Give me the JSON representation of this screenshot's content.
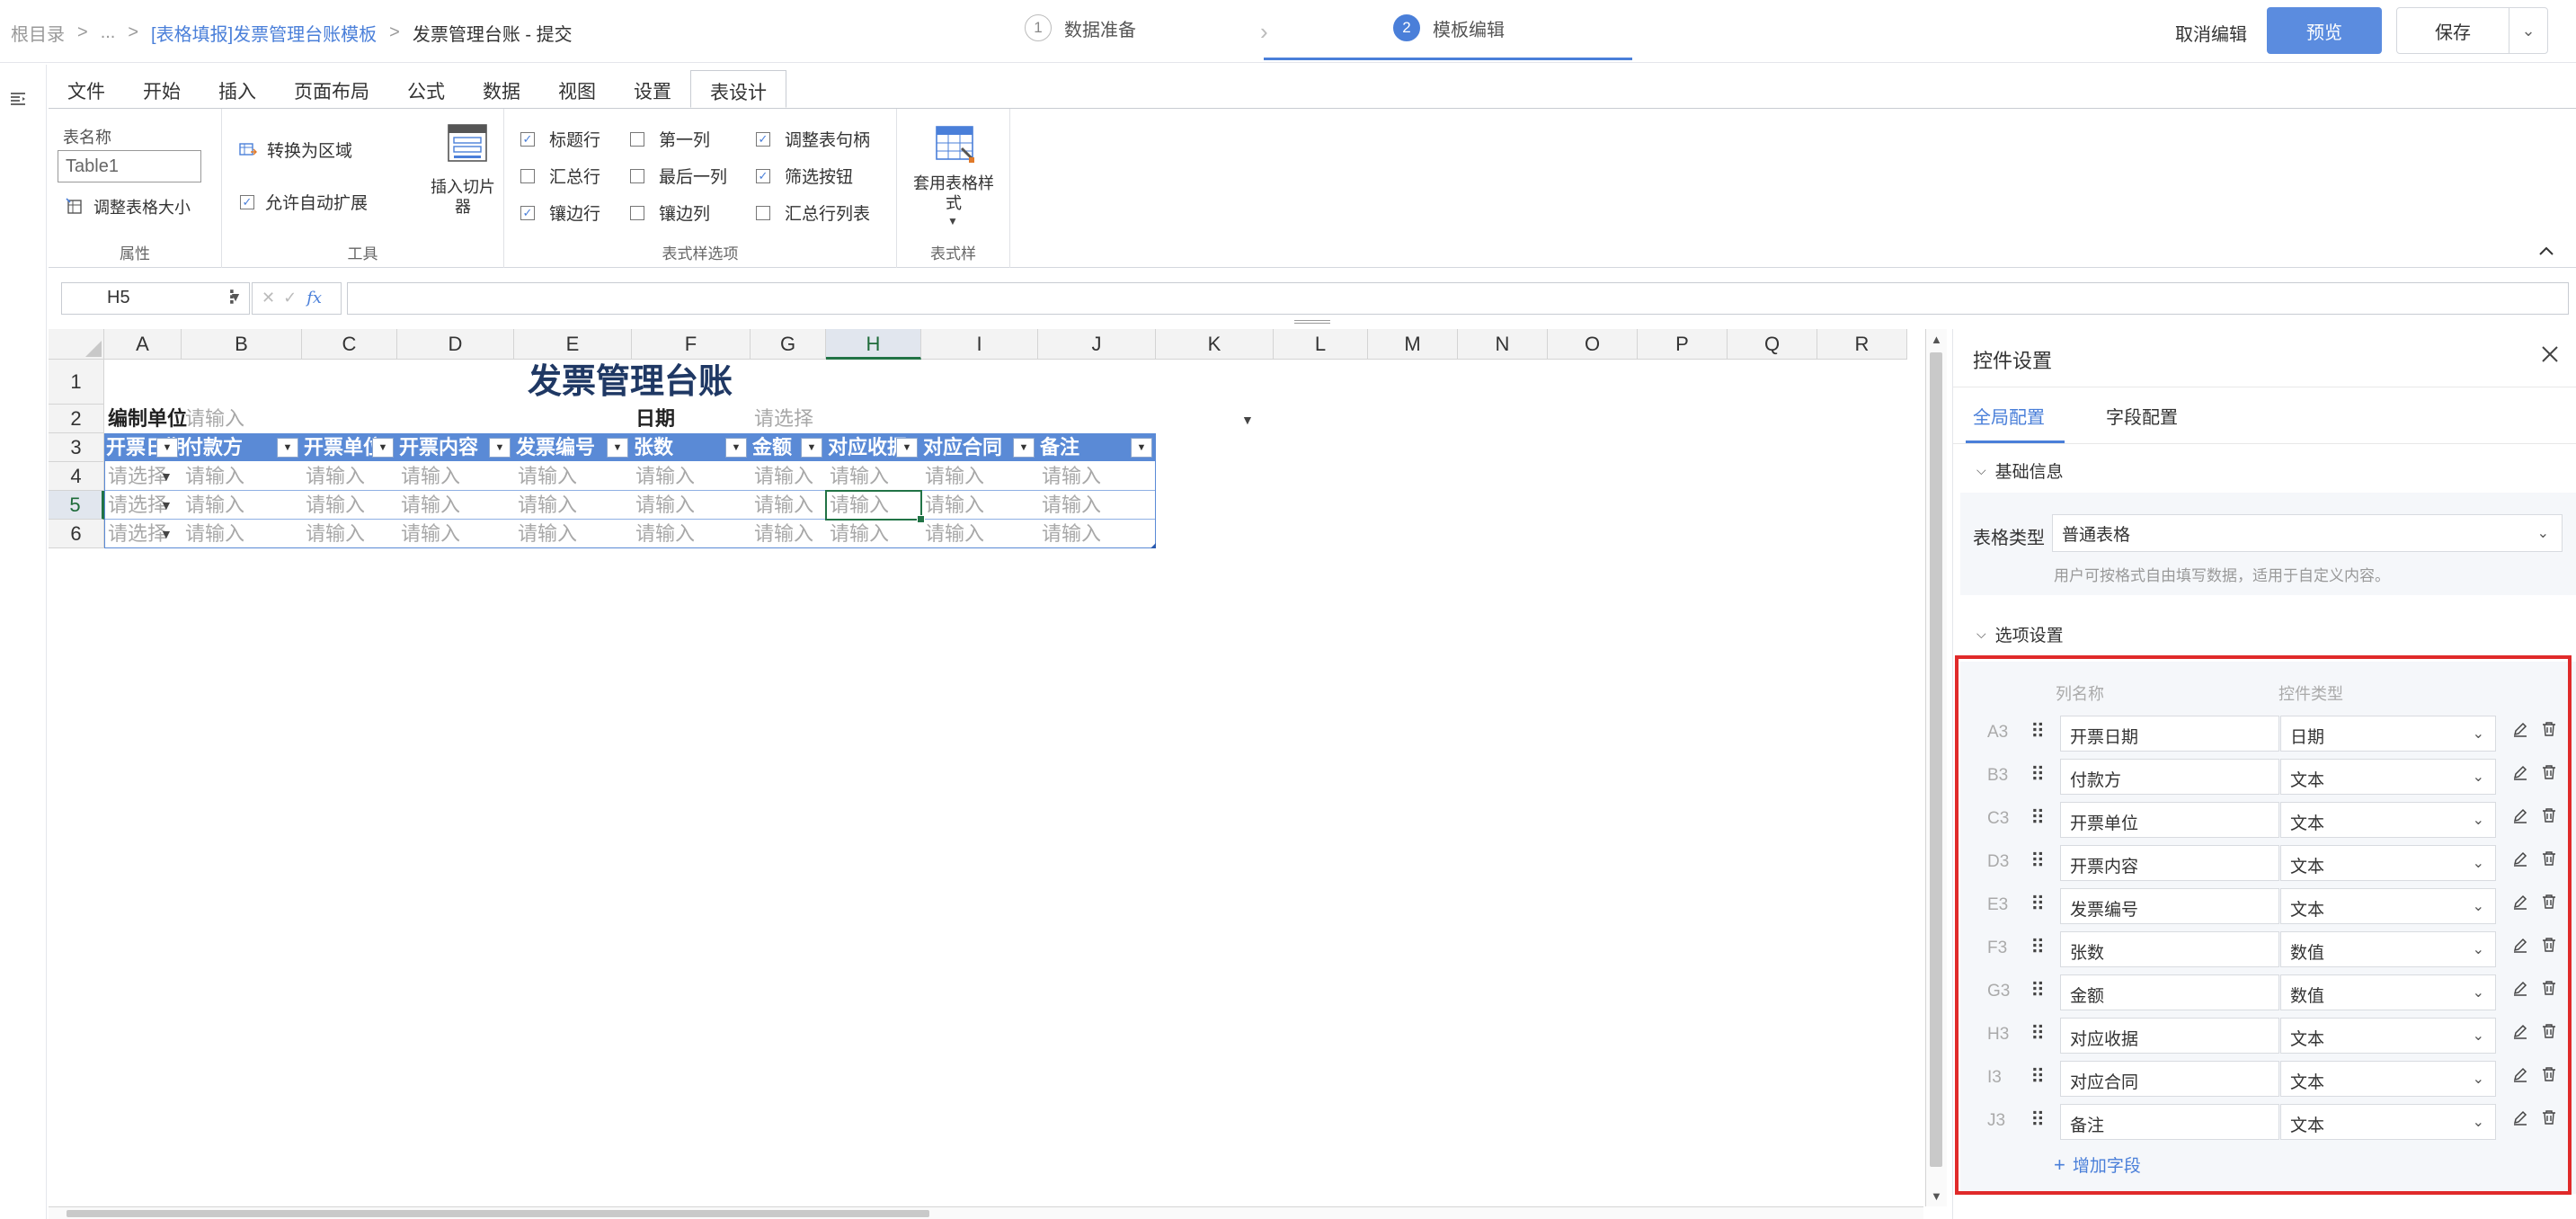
{
  "topbar": {
    "breadcrumb": [
      "根目录",
      "...",
      "[表格填报]发票管理台账模板",
      "发票管理台账 - 提交"
    ],
    "breadcrumb_sep": ">",
    "steps": [
      {
        "num": "1",
        "label": "数据准备"
      },
      {
        "num": "2",
        "label": "模板编辑"
      }
    ],
    "cancel_label": "取消编辑",
    "preview_label": "预览",
    "save_label": "保存"
  },
  "ribbon": {
    "tabs": [
      "文件",
      "开始",
      "插入",
      "页面布局",
      "公式",
      "数据",
      "视图",
      "设置",
      "表设计"
    ],
    "active_tab": "表设计",
    "groups": {
      "properties": {
        "title": "属性",
        "table_name_label": "表名称",
        "table_name_value": "Table1",
        "resize_label": "调整表格大小"
      },
      "tools": {
        "title": "工具",
        "convert_label": "转换为区域",
        "autoexpand_label": "允许自动扩展",
        "slicer_label": "插入切片器"
      },
      "style_options": {
        "title": "表式样选项",
        "options": [
          {
            "label": "标题行",
            "checked": true
          },
          {
            "label": "汇总行",
            "checked": false
          },
          {
            "label": "镶边行",
            "checked": true
          },
          {
            "label": "第一列",
            "checked": false
          },
          {
            "label": "最后一列",
            "checked": false
          },
          {
            "label": "镶边列",
            "checked": false
          },
          {
            "label": "调整表句柄",
            "checked": true
          },
          {
            "label": "筛选按钮",
            "checked": true
          },
          {
            "label": "汇总行列表",
            "checked": false
          }
        ]
      },
      "styles": {
        "title": "表式样",
        "apply_label": "套用表格样式"
      }
    }
  },
  "formula_bar": {
    "name_box": "H5",
    "formula": ""
  },
  "sheet": {
    "columns": [
      "A",
      "B",
      "C",
      "D",
      "E",
      "F",
      "G",
      "H",
      "I",
      "J",
      "K",
      "L",
      "M",
      "N",
      "O",
      "P",
      "Q",
      "R"
    ],
    "selected_column": "H",
    "rows": [
      "1",
      "2",
      "3",
      "4",
      "5",
      "6"
    ],
    "selected_row": "5",
    "title": "发票管理台账",
    "row2": {
      "unit_label": "编制单位",
      "unit_placeholder": "请输入",
      "date_label": "日期",
      "date_placeholder": "请选择"
    },
    "headers": [
      "开票日期",
      "付款方",
      "开票单位",
      "开票内容",
      "发票编号",
      "张数",
      "金额",
      "对应收据",
      "对应合同",
      "备注"
    ],
    "select_placeholder": "请选择",
    "input_placeholder": "请输入"
  },
  "panel": {
    "title": "控件设置",
    "tabs": [
      "全局配置",
      "字段配置"
    ],
    "basic_section": "基础信息",
    "table_type_label": "表格类型",
    "table_type_value": "普通表格",
    "table_type_hint": "用户可按格式自由填写数据，适用于自定义内容。",
    "options_section": "选项设置",
    "col_name_header": "列名称",
    "control_type_header": "控件类型",
    "fields": [
      {
        "ref": "A3",
        "name": "开票日期",
        "type": "日期"
      },
      {
        "ref": "B3",
        "name": "付款方",
        "type": "文本"
      },
      {
        "ref": "C3",
        "name": "开票单位",
        "type": "文本"
      },
      {
        "ref": "D3",
        "name": "开票内容",
        "type": "文本"
      },
      {
        "ref": "E3",
        "name": "发票编号",
        "type": "文本"
      },
      {
        "ref": "F3",
        "name": "张数",
        "type": "数值"
      },
      {
        "ref": "G3",
        "name": "金额",
        "type": "数值"
      },
      {
        "ref": "H3",
        "name": "对应收据",
        "type": "文本"
      },
      {
        "ref": "I3",
        "name": "对应合同",
        "type": "文本"
      },
      {
        "ref": "J3",
        "name": "备注",
        "type": "文本"
      }
    ],
    "add_field_label": "增加字段"
  },
  "colors": {
    "accent": "#4a7fd9",
    "table_header": "#5a8ad6",
    "title_text": "#1f3864",
    "highlight_box": "#e02a2a",
    "selection": "#217346"
  }
}
